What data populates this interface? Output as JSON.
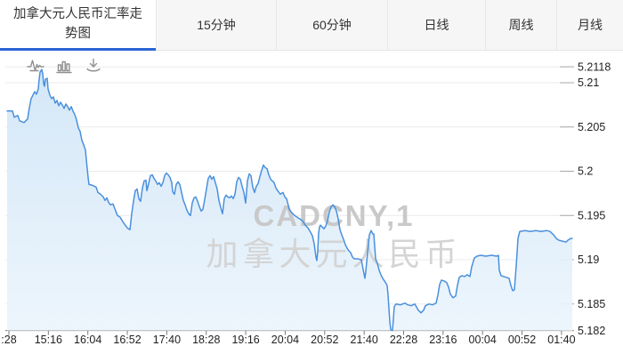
{
  "header": {
    "active_tab": "加拿大元人民币汇率走势图",
    "tabs": [
      "15分钟",
      "60分钟",
      "日线",
      "周线",
      "月线"
    ],
    "accent_color": "#2a63d4"
  },
  "toolbar": {
    "icons": [
      "line-chart",
      "bar-chart",
      "download"
    ]
  },
  "watermark": {
    "line1": "CADCNY,1",
    "line2": "加拿大元人民币"
  },
  "chart_data": {
    "type": "area",
    "title": "加拿大元人民币汇率走势图",
    "symbol": "CADCNY",
    "interval": "1",
    "grid": true,
    "legend_position": "none",
    "ylim": [
      5.182,
      5.2118
    ],
    "line_color": "#4a90dd",
    "fill_color_top": "#d0e5f7",
    "fill_color_bottom": "#ecf5fc",
    "gridline_color": "#ebebeb",
    "axis_color": "#7d7d7d",
    "label_color": "#1f1f1f",
    "watermark_color1": "#c9c9c9",
    "watermark_color2": "#d4d4d4",
    "y_axis": {
      "tick_values": [
        5.2118,
        5.21,
        5.205,
        5.2,
        5.195,
        5.19,
        5.185,
        5.182
      ],
      "tick_labels": [
        "5.2118",
        "5.21",
        "5.205",
        "5.2",
        "5.195",
        "5.19",
        "5.185",
        "5.182"
      ]
    },
    "x_axis": {
      "labels": [
        ":28",
        "15:16",
        "16:04",
        "16:52",
        "17:40",
        "18:28",
        "19:16",
        "20:04",
        "20:52",
        "21:40",
        "22:28",
        "23:16",
        "00:04",
        "00:52",
        "01:40"
      ]
    },
    "points": [
      [
        8,
        5.2068
      ],
      [
        14,
        5.2068
      ],
      [
        16,
        5.2061
      ],
      [
        20,
        5.2063
      ],
      [
        22,
        5.2057
      ],
      [
        27,
        5.2055
      ],
      [
        31,
        5.2059
      ],
      [
        33,
        5.2072
      ],
      [
        35,
        5.2082
      ],
      [
        37,
        5.2086
      ],
      [
        39,
        5.209
      ],
      [
        41,
        5.2087
      ],
      [
        43,
        5.2093
      ],
      [
        44,
        5.2104
      ],
      [
        45,
        5.2112
      ],
      [
        47,
        5.2115
      ],
      [
        48,
        5.211
      ],
      [
        49,
        5.2099
      ],
      [
        50,
        5.2096
      ],
      [
        51,
        5.2104
      ],
      [
        53,
        5.2105
      ],
      [
        54,
        5.2093
      ],
      [
        56,
        5.2086
      ],
      [
        58,
        5.2082
      ],
      [
        60,
        5.2084
      ],
      [
        62,
        5.2077
      ],
      [
        64,
        5.208
      ],
      [
        66,
        5.2074
      ],
      [
        68,
        5.2078
      ],
      [
        70,
        5.2075
      ],
      [
        72,
        5.2071
      ],
      [
        74,
        5.2076
      ],
      [
        76,
        5.2073
      ],
      [
        78,
        5.2069
      ],
      [
        80,
        5.2073
      ],
      [
        82,
        5.2068
      ],
      [
        84,
        5.2064
      ],
      [
        86,
        5.2058
      ],
      [
        88,
        5.2049
      ],
      [
        90,
        5.2045
      ],
      [
        92,
        5.2035
      ],
      [
        94,
        5.203
      ],
      [
        96,
        5.2024
      ],
      [
        97,
        5.2013
      ],
      [
        98,
        5.2003
      ],
      [
        99,
        5.1993
      ],
      [
        100,
        5.1985
      ],
      [
        104,
        5.1984
      ],
      [
        108,
        5.1982
      ],
      [
        110,
        5.1976
      ],
      [
        113,
        5.1974
      ],
      [
        116,
        5.1971
      ],
      [
        118,
        5.1967
      ],
      [
        120,
        5.197
      ],
      [
        122,
        5.1965
      ],
      [
        124,
        5.1962
      ],
      [
        127,
        5.1963
      ],
      [
        130,
        5.1955
      ],
      [
        132,
        5.195
      ],
      [
        135,
        5.1948
      ],
      [
        138,
        5.1943
      ],
      [
        140,
        5.194
      ],
      [
        143,
        5.1936
      ],
      [
        146,
        5.1934
      ],
      [
        148,
        5.1952
      ],
      [
        150,
        5.1966
      ],
      [
        152,
        5.1978
      ],
      [
        154,
        5.198
      ],
      [
        156,
        5.1969
      ],
      [
        158,
        5.1966
      ],
      [
        160,
        5.1981
      ],
      [
        162,
        5.1989
      ],
      [
        164,
        5.199
      ],
      [
        165,
        5.1978
      ],
      [
        167,
        5.1986
      ],
      [
        169,
        5.1995
      ],
      [
        171,
        5.1996
      ],
      [
        173,
        5.1992
      ],
      [
        175,
        5.1989
      ],
      [
        177,
        5.1985
      ],
      [
        179,
        5.1987
      ],
      [
        181,
        5.1983
      ],
      [
        183,
        5.1987
      ],
      [
        185,
        5.1995
      ],
      [
        187,
        5.1998
      ],
      [
        189,
        5.1996
      ],
      [
        191,
        5.1993
      ],
      [
        193,
        5.1987
      ],
      [
        194,
        5.1977
      ],
      [
        196,
        5.1974
      ],
      [
        198,
        5.1985
      ],
      [
        200,
        5.1988
      ],
      [
        202,
        5.1985
      ],
      [
        204,
        5.1976
      ],
      [
        206,
        5.1967
      ],
      [
        208,
        5.1962
      ],
      [
        210,
        5.1956
      ],
      [
        212,
        5.1952
      ],
      [
        214,
        5.195
      ],
      [
        216,
        5.1964
      ],
      [
        218,
        5.197
      ],
      [
        220,
        5.1971
      ],
      [
        222,
        5.1966
      ],
      [
        224,
        5.196
      ],
      [
        226,
        5.1955
      ],
      [
        228,
        5.1957
      ],
      [
        230,
        5.1968
      ],
      [
        232,
        5.198
      ],
      [
        234,
        5.1992
      ],
      [
        236,
        5.1995
      ],
      [
        238,
        5.1991
      ],
      [
        240,
        5.1994
      ],
      [
        242,
        5.1987
      ],
      [
        244,
        5.198
      ],
      [
        246,
        5.1967
      ],
      [
        248,
        5.1959
      ],
      [
        250,
        5.1952
      ],
      [
        252,
        5.1969
      ],
      [
        254,
        5.1973
      ],
      [
        256,
        5.1971
      ],
      [
        258,
        5.197
      ],
      [
        260,
        5.1972
      ],
      [
        262,
        5.1969
      ],
      [
        264,
        5.1974
      ],
      [
        266,
        5.1988
      ],
      [
        268,
        5.1993
      ],
      [
        270,
        5.1991
      ],
      [
        272,
        5.1983
      ],
      [
        274,
        5.1976
      ],
      [
        276,
        5.1964
      ],
      [
        278,
        5.1989
      ],
      [
        280,
        5.1997
      ],
      [
        282,
        5.1995
      ],
      [
        284,
        5.1982
      ],
      [
        286,
        5.1976
      ],
      [
        288,
        5.1983
      ],
      [
        290,
        5.1986
      ],
      [
        292,
        5.1994
      ],
      [
        294,
        5.2001
      ],
      [
        296,
        5.2007
      ],
      [
        298,
        5.2004
      ],
      [
        300,
        5.2003
      ],
      [
        302,
        5.1996
      ],
      [
        304,
        5.1991
      ],
      [
        306,
        5.1989
      ],
      [
        308,
        5.1987
      ],
      [
        310,
        5.1981
      ],
      [
        312,
        5.1978
      ],
      [
        315,
        5.1974
      ],
      [
        318,
        5.1976
      ],
      [
        320,
        5.1971
      ],
      [
        322,
        5.1969
      ],
      [
        325,
        5.1957
      ],
      [
        328,
        5.1953
      ],
      [
        331,
        5.195
      ],
      [
        334,
        5.1948
      ],
      [
        337,
        5.1946
      ],
      [
        340,
        5.1944
      ],
      [
        343,
        5.1939
      ],
      [
        346,
        5.1936
      ],
      [
        349,
        5.1931
      ],
      [
        351,
        5.1927
      ],
      [
        353,
        5.1918
      ],
      [
        355,
        5.1903
      ],
      [
        356,
        5.1899
      ],
      [
        357,
        5.191
      ],
      [
        358,
        5.193
      ],
      [
        359,
        5.1937
      ],
      [
        360,
        5.1939
      ],
      [
        362,
        5.1937
      ],
      [
        364,
        5.1935
      ],
      [
        366,
        5.1938
      ],
      [
        368,
        5.1944
      ],
      [
        370,
        5.1954
      ],
      [
        372,
        5.196
      ],
      [
        374,
        5.1962
      ],
      [
        376,
        5.196
      ],
      [
        378,
        5.1955
      ],
      [
        380,
        5.1946
      ],
      [
        382,
        5.1934
      ],
      [
        384,
        5.1928
      ],
      [
        386,
        5.1923
      ],
      [
        388,
        5.1917
      ],
      [
        390,
        5.1913
      ],
      [
        392,
        5.191
      ],
      [
        394,
        5.1908
      ],
      [
        396,
        5.1903
      ],
      [
        398,
        5.1901
      ],
      [
        402,
        5.1901
      ],
      [
        406,
        5.19
      ],
      [
        408,
        5.1889
      ],
      [
        410,
        5.1879
      ],
      [
        411,
        5.1887
      ],
      [
        413,
        5.1908
      ],
      [
        415,
        5.1928
      ],
      [
        417,
        5.1933
      ],
      [
        419,
        5.1929
      ],
      [
        420,
        5.1929
      ],
      [
        421,
        5.1915
      ],
      [
        422,
        5.1901
      ],
      [
        424,
        5.1896
      ],
      [
        426,
        5.1888
      ],
      [
        428,
        5.1883
      ],
      [
        430,
        5.1879
      ],
      [
        432,
        5.1876
      ],
      [
        434,
        5.1873
      ],
      [
        435,
        5.1871
      ],
      [
        436,
        5.186
      ],
      [
        437,
        5.1845
      ],
      [
        438,
        5.183
      ],
      [
        439,
        5.1821
      ],
      [
        441,
        5.182
      ],
      [
        442,
        5.1833
      ],
      [
        443,
        5.1847
      ],
      [
        445,
        5.185
      ],
      [
        450,
        5.1849
      ],
      [
        455,
        5.1851
      ],
      [
        458,
        5.1849
      ],
      [
        462,
        5.1848
      ],
      [
        466,
        5.185
      ],
      [
        470,
        5.1843
      ],
      [
        473,
        5.184
      ],
      [
        476,
        5.1843
      ],
      [
        478,
        5.1848
      ],
      [
        482,
        5.185
      ],
      [
        486,
        5.1849
      ],
      [
        490,
        5.1851
      ],
      [
        492,
        5.186
      ],
      [
        494,
        5.1872
      ],
      [
        496,
        5.1877
      ],
      [
        499,
        5.1876
      ],
      [
        502,
        5.1874
      ],
      [
        504,
        5.1869
      ],
      [
        506,
        5.1861
      ],
      [
        509,
        5.1857
      ],
      [
        512,
        5.1859
      ],
      [
        514,
        5.1871
      ],
      [
        516,
        5.188
      ],
      [
        519,
        5.1882
      ],
      [
        522,
        5.1881
      ],
      [
        525,
        5.1883
      ],
      [
        528,
        5.1881
      ],
      [
        530,
        5.1892
      ],
      [
        533,
        5.1902
      ],
      [
        536,
        5.1904
      ],
      [
        540,
        5.1905
      ],
      [
        546,
        5.1904
      ],
      [
        552,
        5.1905
      ],
      [
        558,
        5.1904
      ],
      [
        560,
        5.1905
      ],
      [
        561,
        5.1888
      ],
      [
        563,
        5.1882
      ],
      [
        566,
        5.1881
      ],
      [
        569,
        5.188
      ],
      [
        572,
        5.1879
      ],
      [
        574,
        5.1871
      ],
      [
        576,
        5.1865
      ],
      [
        578,
        5.1866
      ],
      [
        580,
        5.1893
      ],
      [
        581,
        5.1908
      ],
      [
        582,
        5.1924
      ],
      [
        584,
        5.1932
      ],
      [
        590,
        5.1933
      ],
      [
        596,
        5.1932
      ],
      [
        602,
        5.1933
      ],
      [
        608,
        5.1932
      ],
      [
        614,
        5.1933
      ],
      [
        618,
        5.1932
      ],
      [
        620,
        5.193
      ],
      [
        622,
        5.1928
      ],
      [
        625,
        5.1924
      ],
      [
        628,
        5.1922
      ],
      [
        632,
        5.1921
      ],
      [
        636,
        5.192
      ],
      [
        638,
        5.1922
      ],
      [
        641,
        5.1924
      ],
      [
        643,
        5.1924
      ]
    ]
  }
}
